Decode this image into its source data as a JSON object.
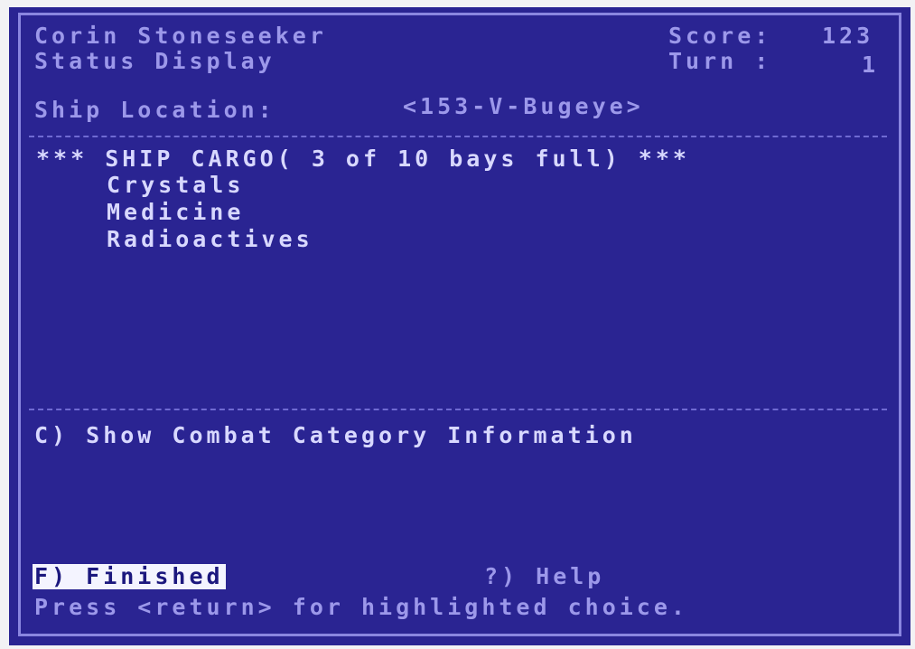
{
  "header": {
    "player_name": "Corin Stoneseeker",
    "screen_title": "Status Display",
    "score_label": "Score:",
    "score_value": "123",
    "turn_label": "Turn :",
    "turn_value": "1"
  },
  "location": {
    "label": "Ship Location:",
    "value": "<153-V-Bugeye>"
  },
  "cargo": {
    "heading": "*** SHIP CARGO( 3 of 10 bays full) ***",
    "items": [
      "Crystals",
      "Medicine",
      "Radioactives"
    ]
  },
  "menu": {
    "show_combat": "C) Show Combat Category Information",
    "finished": "F) Finished",
    "help": "?) Help",
    "prompt": "Press <return> for highlighted choice."
  },
  "colors": {
    "background": "#2a2492",
    "text": "#9c98ea",
    "text_bright": "#d8d8ff",
    "highlight_bg": "#f4f4ff"
  }
}
